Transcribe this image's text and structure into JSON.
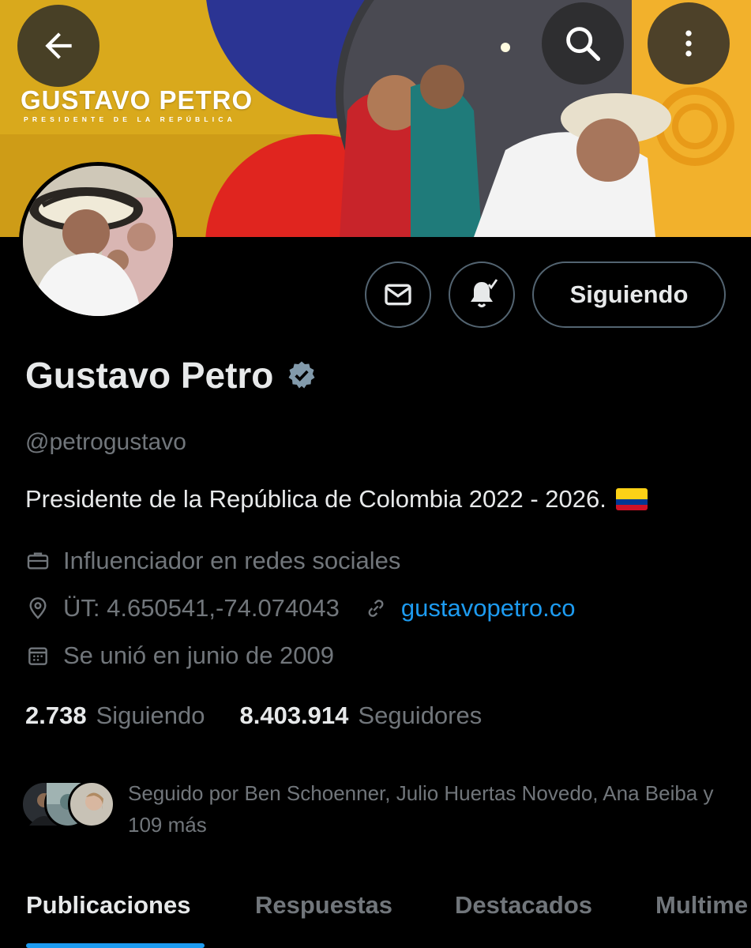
{
  "header": {
    "banner_title": "GUSTAVO PETRO",
    "banner_subtitle": "PRESIDENTE DE LA REPÚBLICA",
    "back_icon": "arrow-left-icon",
    "search_icon": "search-icon",
    "more_icon": "more-vertical-icon"
  },
  "actions": {
    "message_icon": "envelope-icon",
    "notifications_icon": "bell-check-icon",
    "follow_label": "Siguiendo"
  },
  "profile": {
    "name": "Gustavo Petro",
    "verified_icon": "verified-badge-icon",
    "handle": "@petrogustavo",
    "bio": "Presidente de la República de Colombia 2022 - 2026.",
    "bio_emoji": "colombia-flag-emoji",
    "category": "Influenciador en redes sociales",
    "location": "ÜT: 4.650541,-74.074043",
    "website": "gustavopetro.co",
    "joined": "Se unió en junio de 2009"
  },
  "stats": {
    "following_count": "2.738",
    "following_label": "Siguiendo",
    "followers_count": "8.403.914",
    "followers_label": "Seguidores"
  },
  "followed_by": {
    "text": "Seguido por Ben Schoenner, Julio Huertas Novedo, Ana Beiba y 109 más"
  },
  "tabs": [
    "Publicaciones",
    "Respuestas",
    "Destacados",
    "Multime"
  ],
  "colors": {
    "background": "#000000",
    "text_primary": "#e7e9ea",
    "text_secondary": "#71767b",
    "accent": "#1d9bf0",
    "border": "#536471"
  }
}
